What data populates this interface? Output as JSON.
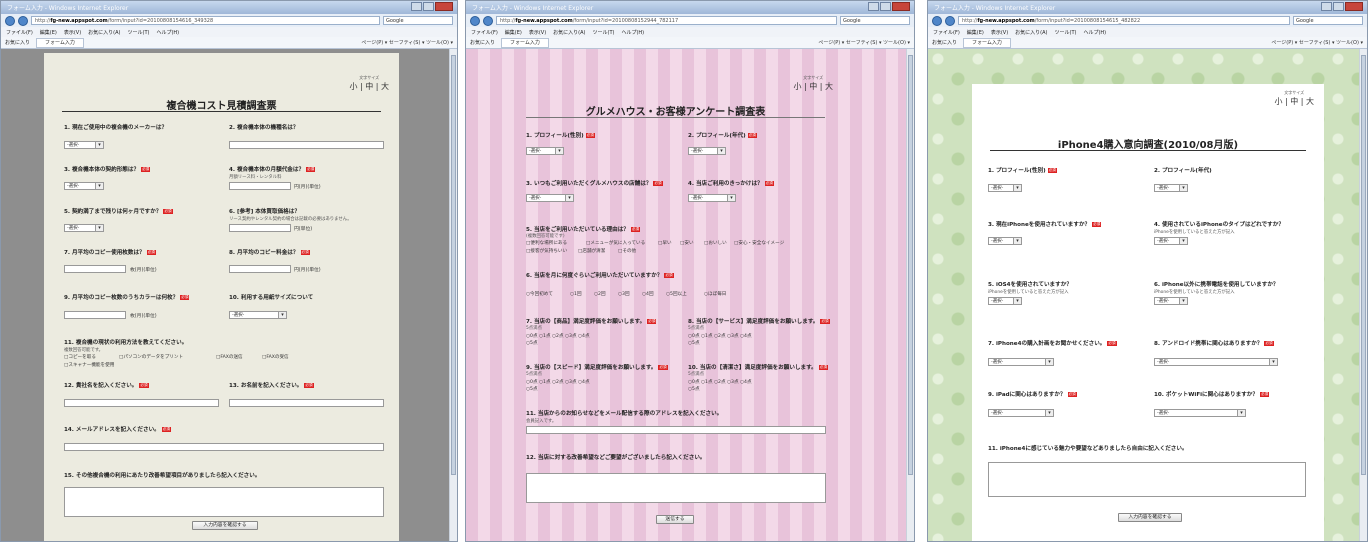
{
  "windows": [
    {
      "title": "フォーム入力 - Windows Internet Explorer",
      "address_host": "fg-new.appspot.com",
      "address_path": "/form/input?id=20100808154616_349328",
      "search_label": "Google",
      "menu": [
        "ファイル(F)",
        "編集(E)",
        "表示(V)",
        "お気に入り(A)",
        "ツール(T)",
        "ヘルプ(H)"
      ],
      "favorites_label": "お気に入り",
      "tab_label": "フォーム入力",
      "tools_label": "ページ(P) ▾  セーフティ(S) ▾  ツール(O) ▾",
      "font_size_label": "文字サイズ",
      "font_size_options": "小 | 中 | 大",
      "form_title": "複合機コスト見積調査票",
      "required_label": "必須",
      "select_default": "-選択-",
      "questions": {
        "q1": "1. 現在ご使用中の複合機のメーカーは？",
        "q2": "2. 複合機本体の機種名は？",
        "q3": "3. 複合機本体の契約形態は？",
        "q4": "4. 複合機本体の月額代金は？",
        "q4_note": "月額リース料・レンタル料",
        "q5": "5. 契約満了まで残りは何ヶ月ですか？",
        "q6": "6. [参考] 本体買取価格は？",
        "q6_note": "リース契約やレンタル契約の場合は記載の必要はありません。",
        "q7": "7. 月平均のコピー使用枚数は？",
        "q8": "8. 月平均のコピー料金は？",
        "q9": "9. 月平均のコピー枚数のうちカラーは何枚？",
        "q10": "10. 利用する用紙サイズについて",
        "q11": "11. 複合機の現状の利用方法を教えてください。",
        "q11_note": "複数回答可能です。",
        "q11_opts": [
          "コピーを取る",
          "パソコンのデータをプリント",
          "FAXの送信",
          "FAXの受信",
          "スキャナー機能を使用"
        ],
        "q12": "12. 貴社名を記入ください。",
        "q13": "13. お名前を記入ください。",
        "q14": "14. メールアドレスを記入ください。",
        "q15": "15. その他複合機の利用にあたり改善希望項目がありましたら記入ください。"
      },
      "units": {
        "yen_unit": "円(月)(単位)",
        "yen_single": "円(単位)",
        "sheets_unit": "枚(月)(単位)"
      },
      "submit": "入力内容を確認する"
    },
    {
      "title": "フォーム入力 - Windows Internet Explorer",
      "address_host": "fg-new.appspot.com",
      "address_path": "/form/input?id=20100808152944_782117",
      "search_label": "Google",
      "menu": [
        "ファイル(F)",
        "編集(E)",
        "表示(V)",
        "お気に入り(A)",
        "ツール(T)",
        "ヘルプ(H)"
      ],
      "favorites_label": "お気に入り",
      "tab_label": "フォーム入力",
      "tools_label": "ページ(P) ▾  セーフティ(S) ▾  ツール(O) ▾",
      "font_size_label": "文字サイズ",
      "font_size_options": "小 | 中 | 大",
      "form_title": "グルメハウス・お客様アンケート調査表",
      "required_label": "必須",
      "select_default": "-選択-",
      "questions": {
        "q1": "1. プロフィール(性別)",
        "q2": "2. プロフィール(年代)",
        "q3": "3. いつもご利用いただくグルメハウスの店舗は？",
        "q4": "4. 当店ご利用のきっかけは？",
        "q5": "5. 当店をご利用いただいている理由は？",
        "q5_note": "(複数回答可能です)",
        "q5_opts": [
          "便利な場所にある",
          "メニューが気に入っている",
          "早い",
          "安い",
          "おいしい",
          "安心・安全なイメージ",
          "接客が気持ちいい",
          "店舗が清潔",
          "その他"
        ],
        "q6": "6. 当店を月に何度ぐらいご利用いただいていますか？",
        "q6_opts": [
          "今回初めて",
          "1回",
          "2回",
          "3回",
          "4回",
          "5回以上",
          "ほぼ毎日"
        ],
        "q7": "7. 当店の【商品】満足度評価をお願いします。",
        "q8": "8. 当店の【サービス】満足度評価をお願いします。",
        "q9": "9. 当店の【スピード】満足度評価をお願いします。",
        "q10": "10. 当店の【清潔さ】満足度評価をお願いします。",
        "rating_note": "5点満点",
        "rating_opts": [
          "0点",
          "1点",
          "2点",
          "3点",
          "4点",
          "5点"
        ],
        "q11": "11. 当店からのお知らせなどをメール配信する際のアドレスを記入ください。",
        "q11_note": "会員記入です。",
        "q12": "12. 当店に対する改善希望などご要望がございましたら記入ください。"
      },
      "submit": "送信する"
    },
    {
      "title": "フォーム入力 - Windows Internet Explorer",
      "address_host": "fg-new.appspot.com",
      "address_path": "/form/input?id=20100808154615_482822",
      "search_label": "Google",
      "menu": [
        "ファイル(F)",
        "編集(E)",
        "表示(V)",
        "お気に入り(A)",
        "ツール(T)",
        "ヘルプ(H)"
      ],
      "favorites_label": "お気に入り",
      "tab_label": "フォーム入力",
      "tools_label": "ページ(P) ▾  セーフティ(S) ▾  ツール(O) ▾",
      "font_size_label": "文字サイズ",
      "font_size_options": "小 | 中 | 大",
      "form_title": "iPhone4購入意向調査(2010/08月版)",
      "required_label": "必須",
      "select_default": "-選択-",
      "questions": {
        "q1": "1. プロフィール(性別)",
        "q2": "2. プロフィール(年代)",
        "q3": "3. 現在iPhoneを使用されていますか？",
        "q4": "4. 使用されているiPhoneのタイプはどれですか？",
        "q4_note": "iPhoneを使用していると答えた方が記入",
        "q5": "5. iOS4を使用されていますか？",
        "q5_note": "iPhoneを使用していると答えた方が記入",
        "q6": "6. iPhone以外に携帯電話を使用していますか？",
        "q6_note": "iPhoneを使用していると答えた方が記入",
        "q7": "7. iPhone4の購入計画をお聞かせください。",
        "q8": "8. アンドロイド携帯に関心はありますか？",
        "q9": "9. iPadに関心はありますか？",
        "q10": "10. ポケットWiFiに関心はありますか？",
        "q11": "11. iPhone4に感じている魅力や要望などありましたら自由に記入ください。"
      },
      "submit": "入力内容を確認する"
    }
  ]
}
